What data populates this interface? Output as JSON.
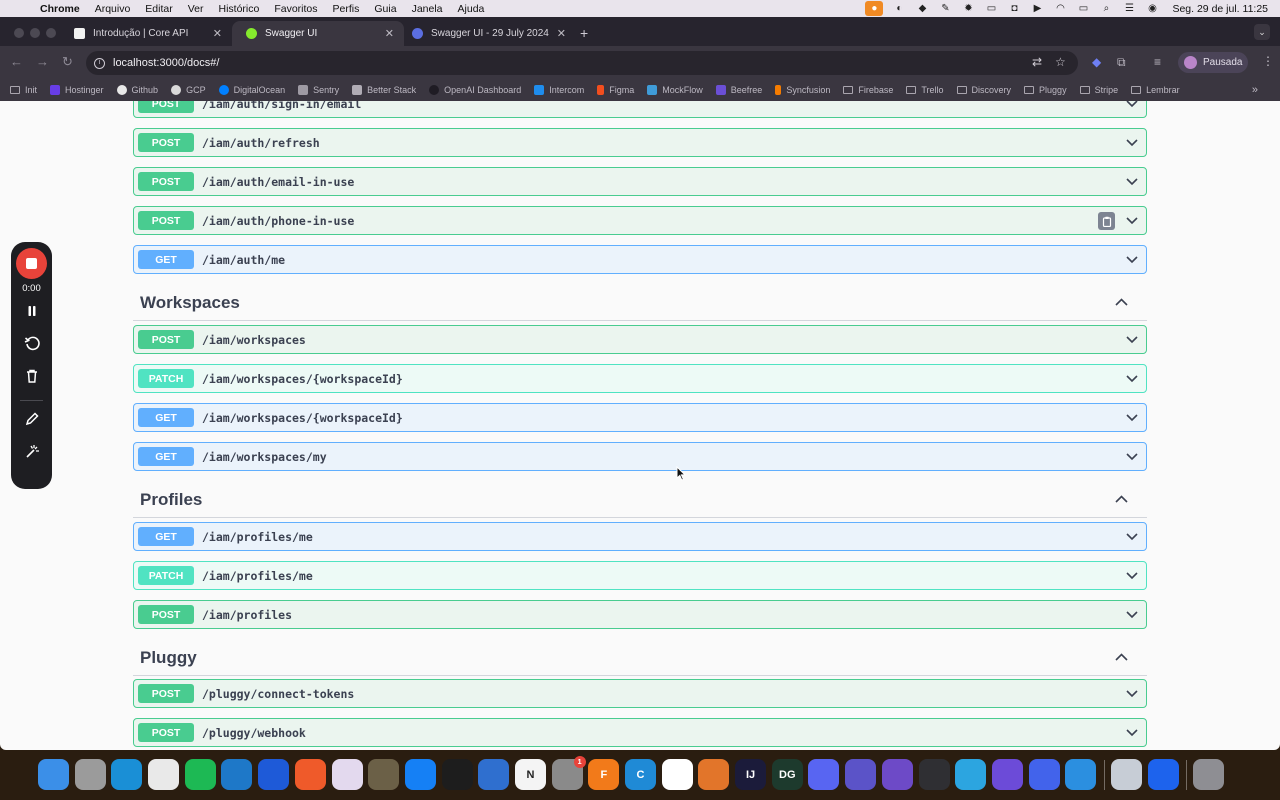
{
  "menubar": {
    "app_name": "Chrome",
    "items": [
      "Arquivo",
      "Editar",
      "Ver",
      "Histórico",
      "Favoritos",
      "Perfis",
      "Guia",
      "Janela",
      "Ajuda"
    ],
    "clock": "Seg. 29 de jul.  11:25"
  },
  "browser": {
    "tabs": [
      {
        "title": "Introdução | Core API",
        "active": false
      },
      {
        "title": "Swagger UI",
        "active": true
      },
      {
        "title": "Swagger UI - 29 July 2024",
        "active": false
      }
    ],
    "url": "localhost:3000/docs#/",
    "profile_label": "Pausada",
    "bookmarks": [
      "Init",
      "Hostinger",
      "Github",
      "GCP",
      "DigitalOcean",
      "Sentry",
      "Better Stack",
      "OpenAI Dashboard",
      "Intercom",
      "Figma",
      "MockFlow",
      "Beefree",
      "Syncfusion",
      "Firebase",
      "Trello",
      "Discovery",
      "Pluggy",
      "Stripe",
      "Lembrar"
    ]
  },
  "swagger": {
    "auth_ops": [
      {
        "method": "POST",
        "path": "/iam/auth/sign-in/email"
      },
      {
        "method": "POST",
        "path": "/iam/auth/refresh"
      },
      {
        "method": "POST",
        "path": "/iam/auth/email-in-use"
      },
      {
        "method": "POST",
        "path": "/iam/auth/phone-in-use"
      },
      {
        "method": "GET",
        "path": "/iam/auth/me"
      }
    ],
    "workspaces": {
      "title": "Workspaces",
      "ops": [
        {
          "method": "POST",
          "path": "/iam/workspaces"
        },
        {
          "method": "PATCH",
          "path": "/iam/workspaces/{workspaceId}"
        },
        {
          "method": "GET",
          "path": "/iam/workspaces/{workspaceId}"
        },
        {
          "method": "GET",
          "path": "/iam/workspaces/my"
        }
      ]
    },
    "profiles": {
      "title": "Profiles",
      "ops": [
        {
          "method": "GET",
          "path": "/iam/profiles/me"
        },
        {
          "method": "PATCH",
          "path": "/iam/profiles/me"
        },
        {
          "method": "POST",
          "path": "/iam/profiles"
        }
      ]
    },
    "pluggy": {
      "title": "Pluggy",
      "ops": [
        {
          "method": "POST",
          "path": "/pluggy/connect-tokens"
        },
        {
          "method": "POST",
          "path": "/pluggy/webhook"
        }
      ]
    }
  },
  "recorder": {
    "time": "0:00"
  },
  "dock": {
    "apps": [
      "Finder",
      "Launchpad",
      "Files",
      "Chrome",
      "Spotify",
      "VS Code",
      "Xcode",
      "Scribe",
      "Slack",
      "GIMP",
      "App Store",
      "Activity Monitor",
      "Xcode Instruments",
      "Notion",
      "System Settings",
      "Fusion 360",
      "Cursor",
      "MongoDB",
      "MATLAB",
      "IntelliJ IDEA",
      "DataGrip",
      "Discord",
      "Fluent",
      "Proton",
      "Unity",
      "Telegram",
      "Rewind",
      "Orbit",
      "VS Code Insiders",
      "Preview",
      "Docker",
      "Trash"
    ],
    "badge_app": "System Settings",
    "badge_count": "1"
  },
  "colors": {
    "post": "#49cc90",
    "patch": "#50e3c2",
    "get": "#61affe",
    "record": "#e8433a"
  }
}
